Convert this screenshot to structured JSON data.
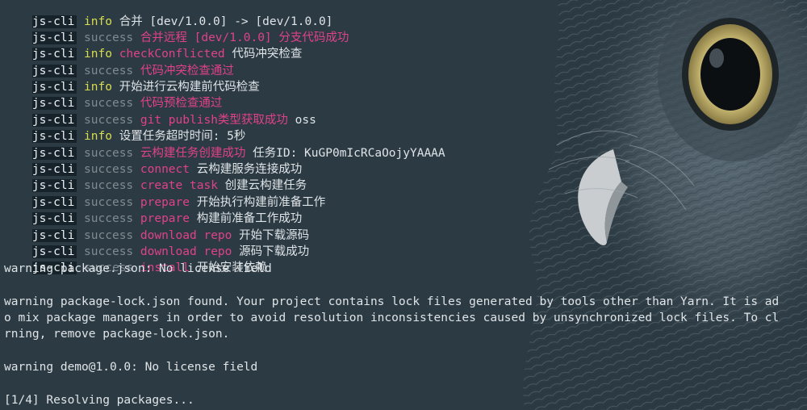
{
  "prompt": "js-cli",
  "colors": {
    "background": "#2c3a43",
    "info": "#d9dd4c",
    "success": "#7f8b91",
    "highlight": "#e0428a",
    "text": "#dfe4e7"
  },
  "log_lines": [
    {
      "level": "info",
      "message": "合并 [dev/1.0.0] -> [dev/1.0.0]"
    },
    {
      "level": "success",
      "highlight": "合并远程 [dev/1.0.0] 分支代码成功",
      "message": ""
    },
    {
      "level": "info",
      "highlight": "checkConflicted",
      "message": "代码冲突检查"
    },
    {
      "level": "success",
      "highlight": "代码冲突检查通过",
      "message": ""
    },
    {
      "level": "info",
      "message": "开始进行云构建前代码检查"
    },
    {
      "level": "success",
      "highlight": "代码预检查通过",
      "message": ""
    },
    {
      "level": "success",
      "highlight": "git publish类型获取成功",
      "message": "oss"
    },
    {
      "level": "info",
      "message": "设置任务超时时间: 5秒"
    },
    {
      "level": "success",
      "highlight": "云构建任务创建成功",
      "message": "任务ID: KuGP0mIcRCaOojyYAAAA"
    },
    {
      "level": "success",
      "highlight": "connect",
      "message": "云构建服务连接成功"
    },
    {
      "level": "success",
      "highlight": "create task",
      "message": "创建云构建任务"
    },
    {
      "level": "success",
      "highlight": "prepare",
      "message": "开始执行构建前准备工作"
    },
    {
      "level": "success",
      "highlight": "prepare",
      "message": "构建前准备工作成功"
    },
    {
      "level": "success",
      "highlight": "download repo",
      "message": "开始下载源码"
    },
    {
      "level": "success",
      "highlight": "download repo",
      "message": "源码下载成功"
    },
    {
      "level": "success",
      "highlight": "install",
      "message": "开始安装依赖"
    }
  ],
  "yarn_output": [
    "warning package.json: No license field",
    "",
    "warning package-lock.json found. Your project contains lock files generated by tools other than Yarn. It is ad",
    "o mix package managers in order to avoid resolution inconsistencies caused by unsynchronized lock files. To cl",
    "rning, remove package-lock.json.",
    "",
    "warning demo@1.0.0: No license field",
    "",
    "[1/4] Resolving packages..."
  ]
}
